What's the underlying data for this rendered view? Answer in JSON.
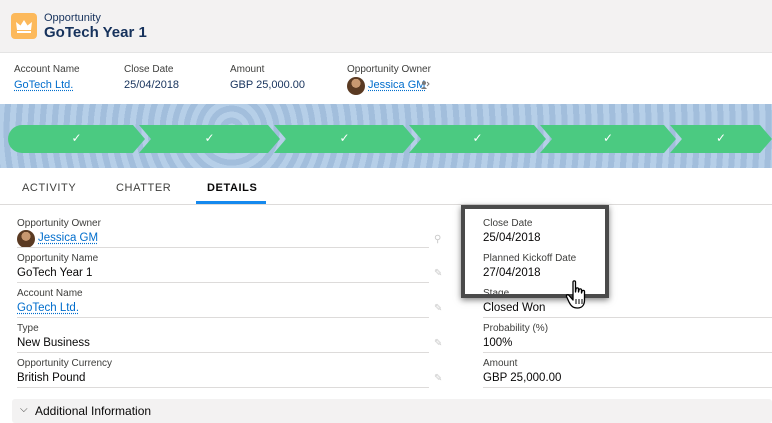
{
  "header": {
    "object_type": "Opportunity",
    "record_name": "GoTech Year 1",
    "icon": "crown-icon"
  },
  "highlights": {
    "account_label": "Account Name",
    "account_value": "GoTech Ltd.",
    "close_label": "Close Date",
    "close_value": "25/04/2018",
    "amount_label": "Amount",
    "amount_value": "GBP 25,000.00",
    "owner_label": "Opportunity Owner",
    "owner_value": "Jessica GM"
  },
  "path": {
    "check": "✓",
    "stages_complete": 6
  },
  "tabs": [
    {
      "label": "ACTIVITY"
    },
    {
      "label": "CHATTER"
    },
    {
      "label": "DETAILS"
    }
  ],
  "details": {
    "left": [
      {
        "label": "Opportunity Owner",
        "value": "Jessica GM"
      },
      {
        "label": "Opportunity Name",
        "value": "GoTech Year 1"
      },
      {
        "label": "Account Name",
        "value": "GoTech Ltd."
      },
      {
        "label": "Type",
        "value": "New Business"
      },
      {
        "label": "Opportunity Currency",
        "value": "British Pound"
      }
    ],
    "right": [
      {
        "label": "Close Date",
        "value": "25/04/2018"
      },
      {
        "label": "Planned Kickoff Date",
        "value": "27/04/2018"
      },
      {
        "label": "Stage",
        "value": "Closed Won"
      },
      {
        "label": "Probability (%)",
        "value": "100%"
      },
      {
        "label": "Amount",
        "value": "GBP 25,000.00"
      }
    ]
  },
  "section": {
    "title": "Additional Information",
    "chevron": "⌵"
  },
  "colors": {
    "accent": "#1589ee",
    "path_complete": "#4bca81",
    "link": "#006dcc",
    "object_icon": "#fcb95b"
  }
}
